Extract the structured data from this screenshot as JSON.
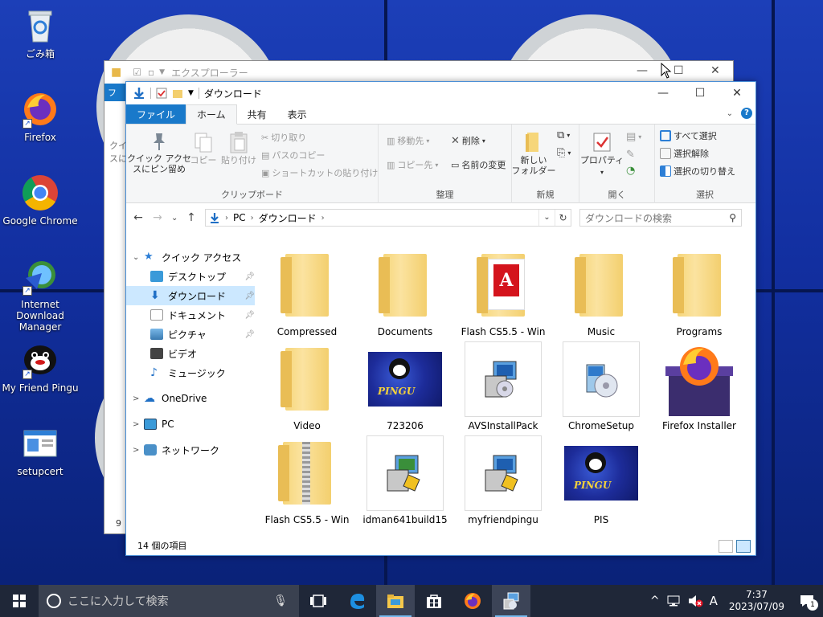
{
  "desktop": {
    "icons": [
      {
        "label": "ごみ箱",
        "icon": "recycle-bin-icon"
      },
      {
        "label": "Firefox",
        "icon": "firefox-icon"
      },
      {
        "label": "Google Chrome",
        "icon": "chrome-icon"
      },
      {
        "label": "Internet Download Manager",
        "icon": "idm-icon"
      },
      {
        "label": "My Friend Pingu",
        "icon": "pingu-icon"
      },
      {
        "label": "setupcert",
        "icon": "setupcert-icon"
      }
    ]
  },
  "back_window": {
    "title": "エクスプローラー",
    "tab_fragment": "ファ",
    "side_fragment": "クイ\nスに",
    "status_fragment": "9"
  },
  "window": {
    "title": "ダウンロード",
    "controls": {
      "minimize": "—",
      "maximize": "☐",
      "close": "✕"
    },
    "tabs": [
      {
        "label": "ファイル",
        "type": "file"
      },
      {
        "label": "ホーム",
        "type": "active"
      },
      {
        "label": "共有",
        "type": "normal"
      },
      {
        "label": "表示",
        "type": "normal"
      }
    ],
    "ribbon": {
      "clipboard": {
        "label": "クリップボード",
        "pin_label": "クイック アクセ\nスにピン留め",
        "copy_label": "コピー",
        "paste_label": "貼り付け",
        "cut_label": "切り取り",
        "copy_path_label": "パスのコピー",
        "paste_shortcut_label": "ショートカットの貼り付け"
      },
      "organize": {
        "label": "整理",
        "move_to_label": "移動先",
        "copy_to_label": "コピー先",
        "delete_label": "削除",
        "rename_label": "名前の変更"
      },
      "new": {
        "label": "新規",
        "new_folder_label": "新しい\nフォルダー"
      },
      "open": {
        "label": "開く",
        "properties_label": "プロパティ"
      },
      "select": {
        "label": "選択",
        "select_all_label": "すべて選択",
        "select_none_label": "選択解除",
        "invert_label": "選択の切り替え"
      }
    },
    "address": {
      "path": [
        "PC",
        "ダウンロード"
      ],
      "search_placeholder": "ダウンロードの検索"
    },
    "nav": [
      {
        "label": "クイック アクセス",
        "expand": "⌄",
        "level": 0,
        "pinned": false,
        "selected": false
      },
      {
        "label": "デスクトップ",
        "expand": "",
        "level": 1,
        "pinned": true,
        "selected": false
      },
      {
        "label": "ダウンロード",
        "expand": "",
        "level": 1,
        "pinned": true,
        "selected": true
      },
      {
        "label": "ドキュメント",
        "expand": "",
        "level": 1,
        "pinned": true,
        "selected": false
      },
      {
        "label": "ピクチャ",
        "expand": "",
        "level": 1,
        "pinned": true,
        "selected": false
      },
      {
        "label": "ビデオ",
        "expand": "",
        "level": 1,
        "pinned": false,
        "selected": false
      },
      {
        "label": "ミュージック",
        "expand": "",
        "level": 1,
        "pinned": false,
        "selected": false
      },
      {
        "label": "OneDrive",
        "expand": ">",
        "level": 0,
        "pinned": false,
        "selected": false
      },
      {
        "label": "PC",
        "expand": ">",
        "level": 0,
        "pinned": false,
        "selected": false
      },
      {
        "label": "ネットワーク",
        "expand": ">",
        "level": 0,
        "pinned": false,
        "selected": false
      }
    ],
    "files": [
      {
        "name": "Compressed",
        "kind": "folder"
      },
      {
        "name": "Documents",
        "kind": "folder"
      },
      {
        "name": "Flash CS5.5 - Win",
        "kind": "adobe-folder"
      },
      {
        "name": "Music",
        "kind": "folder"
      },
      {
        "name": "Programs",
        "kind": "folder"
      },
      {
        "name": "Video",
        "kind": "folder"
      },
      {
        "name": "723206",
        "kind": "pingu-image"
      },
      {
        "name": "AVSInstallPack",
        "kind": "installer"
      },
      {
        "name": "ChromeSetup",
        "kind": "installer-cd"
      },
      {
        "name": "Firefox Installer",
        "kind": "firefox-installer"
      },
      {
        "name": "Flash CS5.5 - Win",
        "kind": "zip"
      },
      {
        "name": "idman641build15",
        "kind": "installer"
      },
      {
        "name": "myfriendpingu",
        "kind": "installer"
      },
      {
        "name": "PIS",
        "kind": "pingu-image"
      }
    ],
    "status": "14 個の項目"
  },
  "taskbar": {
    "search_placeholder": "ここに入力して検索",
    "ime": "A",
    "time": "7:37",
    "date": "2023/07/09",
    "notifications": "1"
  }
}
